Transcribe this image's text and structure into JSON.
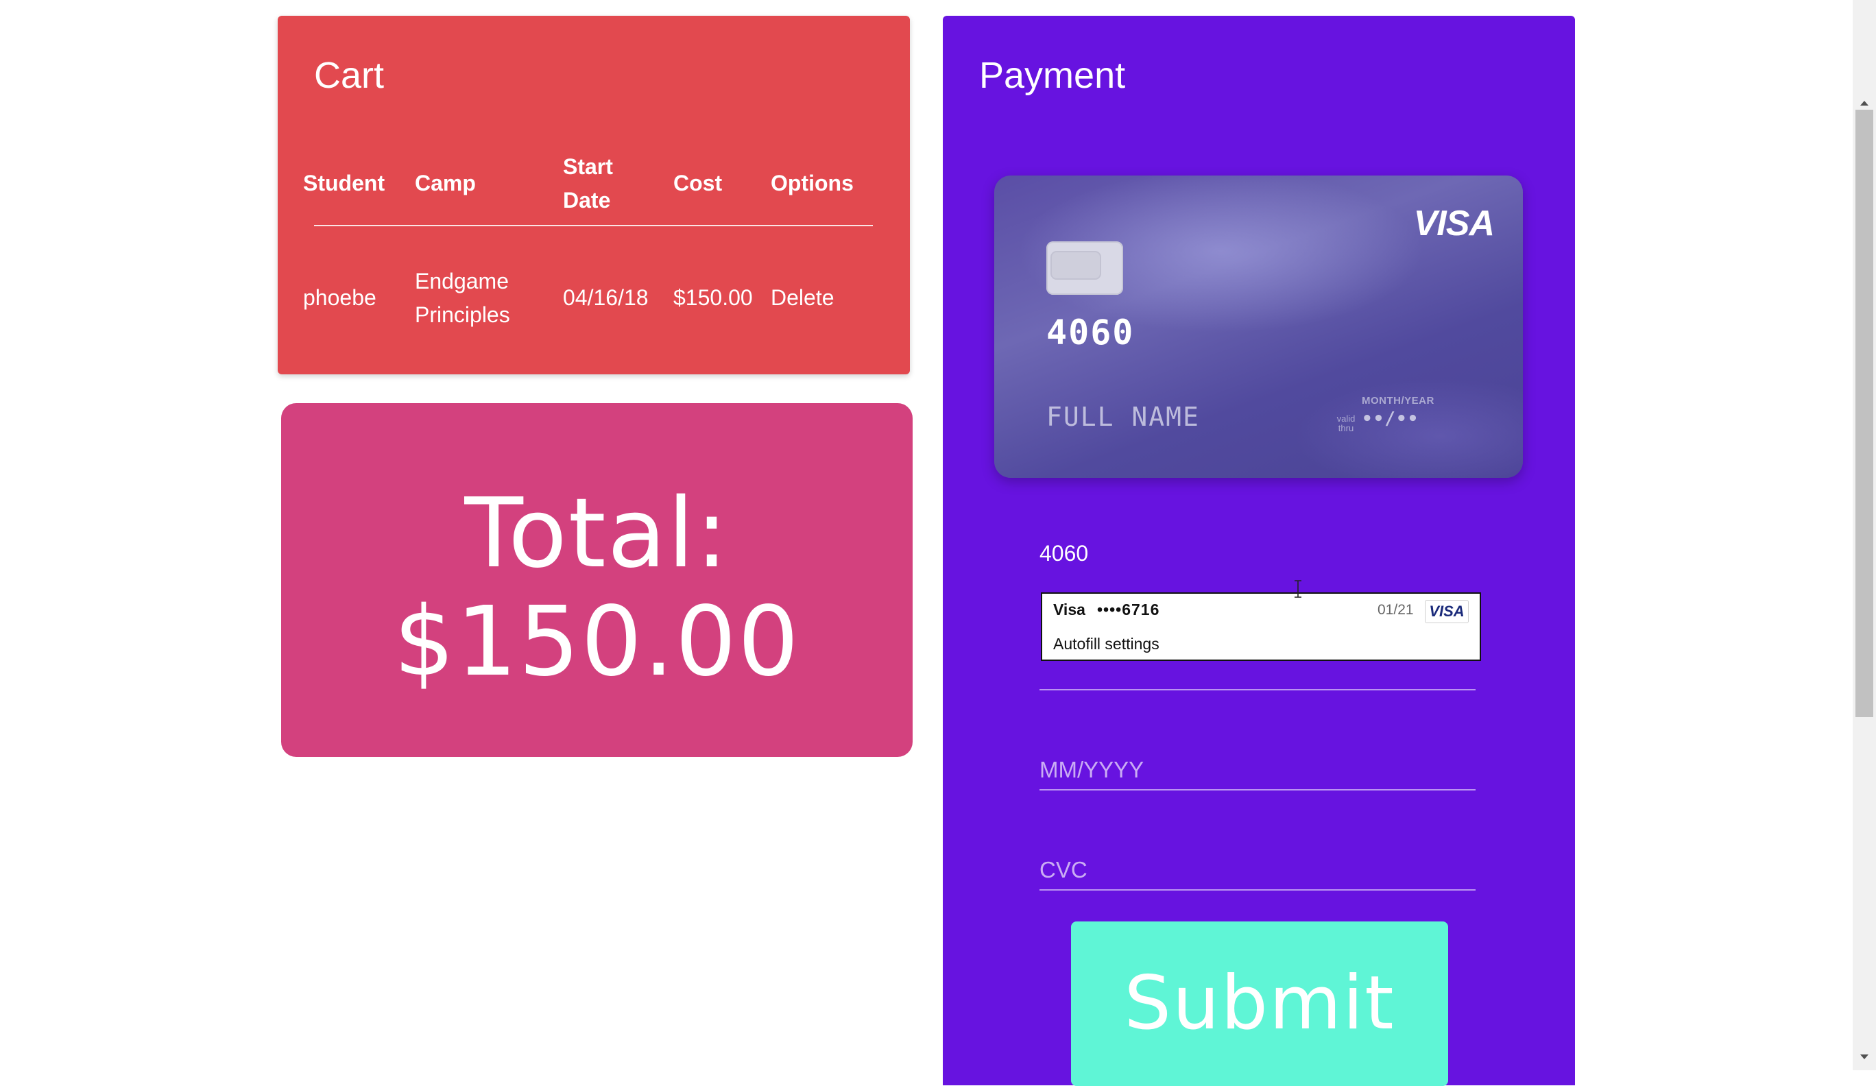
{
  "cart": {
    "title": "Cart",
    "columns": [
      "Student",
      "Camp",
      "Start",
      "Date",
      "Cost",
      "Options"
    ],
    "row": {
      "student": "phoebe",
      "camp_line1": "Endgame",
      "camp_line2": "Principles",
      "start_date": "04/16/18",
      "cost": "$150.00",
      "option": "Delete"
    }
  },
  "total": {
    "line1": "Total:",
    "line2": "$150.00"
  },
  "payment": {
    "title": "Payment",
    "card_preview": {
      "brand": "VISA",
      "number": "4060",
      "name": "FULL NAME",
      "valid_thru": "valid thru",
      "expiry_label": "MONTH/YEAR",
      "expiry": "••/••"
    },
    "fields": {
      "card_number_value": "4060",
      "expiry_placeholder": "MM/YYYY",
      "cvc_placeholder": "CVC"
    },
    "submit_label": "Submit"
  },
  "autofill": {
    "brand": "Visa",
    "masked_number": "••••6716",
    "expiry": "01/21",
    "badge": "VISA",
    "settings_label": "Autofill settings"
  },
  "colors": {
    "cart_bg": "#e2494f",
    "total_bg": "#d3417e",
    "payment_bg": "#6713e0",
    "submit_bg": "#5ff5d6"
  }
}
